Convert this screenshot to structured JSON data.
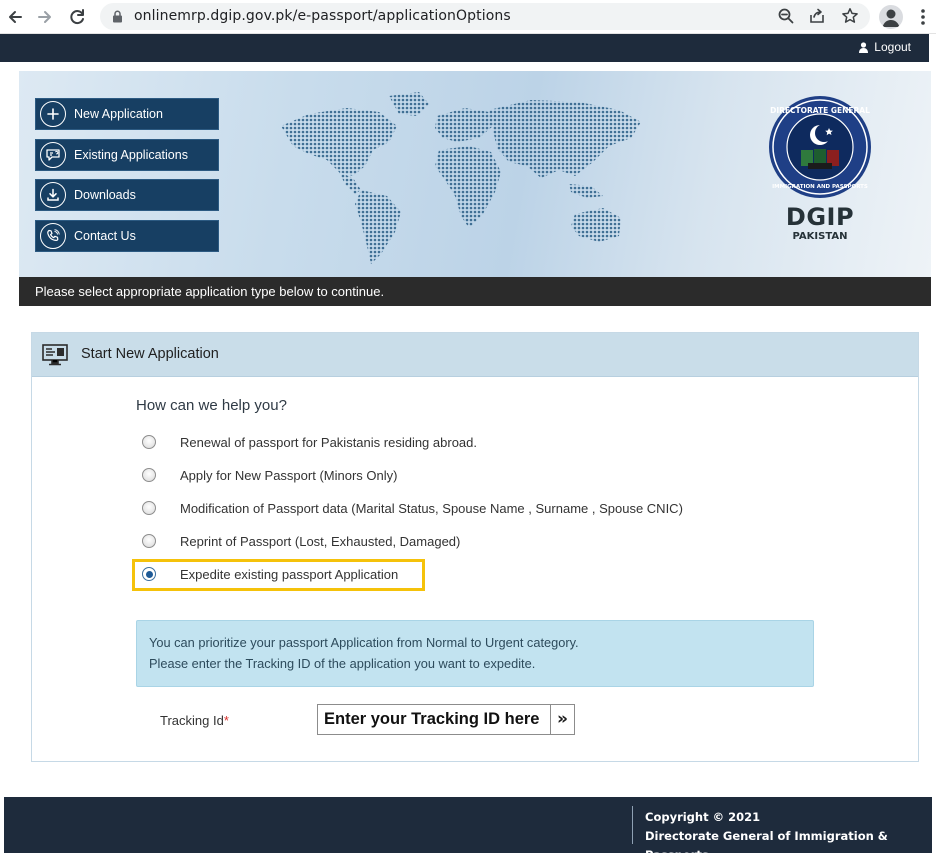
{
  "browser": {
    "url": "onlinemrp.dgip.gov.pk/e-passport/applicationOptions",
    "icons": [
      "back-arrow-icon",
      "forward-arrow-icon",
      "reload-icon",
      "lock-icon",
      "zoom-icon",
      "share-icon",
      "bookmark-star-icon",
      "profile-icon",
      "kebab-menu-icon"
    ]
  },
  "topbar": {
    "logout_label": "Logout"
  },
  "banner": {
    "menu": [
      {
        "label": "New Application",
        "icon": "plus-circle-icon"
      },
      {
        "label": "Existing Applications",
        "icon": "chat-bubble-icon"
      },
      {
        "label": "Downloads",
        "icon": "download-icon"
      },
      {
        "label": "Contact Us",
        "icon": "phone-icon"
      }
    ],
    "logo_title": "DGIP",
    "logo_subtitle": "PAKISTAN",
    "seal_text": "DIRECTORATE GENERAL IMMIGRATION AND PASSPORTS",
    "notice": "Please select appropriate application type below to continue."
  },
  "panel": {
    "title": "Start New Application",
    "question": "How can we help you?",
    "options": [
      {
        "label": "Renewal of passport for Pakistanis residing abroad.",
        "checked": false
      },
      {
        "label": "Apply for New Passport (Minors Only)",
        "checked": false
      },
      {
        "label": "Modification of Passport data (Marital Status, Spouse Name , Surname , Spouse CNIC)",
        "checked": false
      },
      {
        "label": "Reprint of Passport (Lost, Exhausted, Damaged)",
        "checked": false
      },
      {
        "label": "Expedite existing passport Application",
        "checked": true
      }
    ],
    "info_line_1": "You can prioritize your passport Application from Normal to Urgent category.",
    "info_line_2": "Please enter the Tracking ID of the application you want to expedite.",
    "tracking_label": "Tracking Id",
    "required_mark": "*",
    "tracking_placeholder": "Enter your Tracking ID here",
    "go_glyph": "»"
  },
  "footer": {
    "copyright": "Copyright © 2021",
    "org": "Directorate General of Immigration & Passports"
  },
  "colors": {
    "navy": "#1e2b3c",
    "menu_blue": "#173f63",
    "panel_header": "#c9dde9",
    "info_bg": "#c2e3f0",
    "highlight": "#f5c20a",
    "radio_checked": "#1e5a96"
  }
}
